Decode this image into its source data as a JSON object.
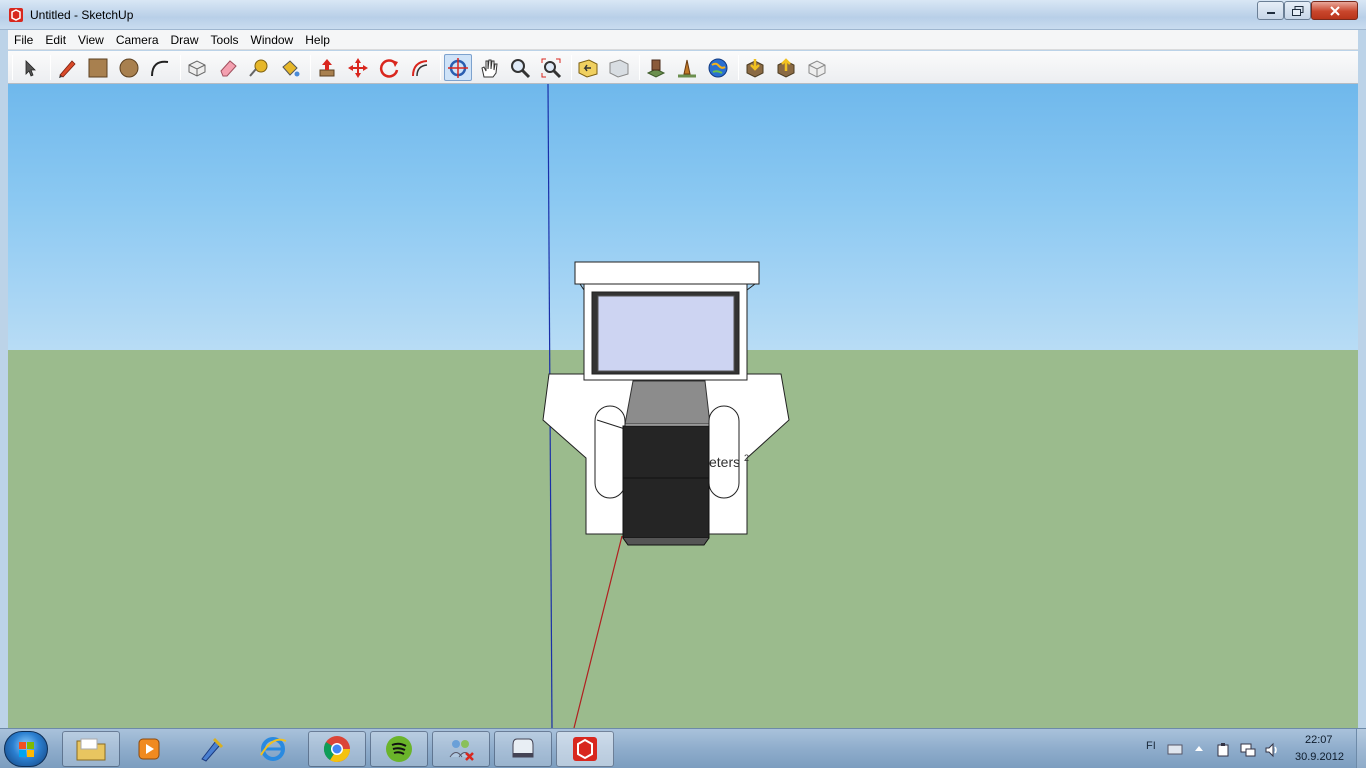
{
  "window": {
    "title": "Untitled - SketchUp"
  },
  "menubar": {
    "items": [
      "File",
      "Edit",
      "View",
      "Camera",
      "Draw",
      "Tools",
      "Window",
      "Help"
    ]
  },
  "toolbar": {
    "tools": [
      {
        "name": "select-tool"
      },
      {
        "name": "line-tool"
      },
      {
        "name": "rectangle-tool"
      },
      {
        "name": "circle-tool"
      },
      {
        "name": "arc-tool"
      },
      {
        "name": "make-component-tool"
      },
      {
        "name": "eraser-tool"
      },
      {
        "name": "tape-measure-tool"
      },
      {
        "name": "paint-bucket-tool"
      },
      {
        "name": "push-pull-tool"
      },
      {
        "name": "move-tool"
      },
      {
        "name": "rotate-tool"
      },
      {
        "name": "offset-tool"
      },
      {
        "name": "orbit-tool",
        "active": true
      },
      {
        "name": "pan-tool"
      },
      {
        "name": "zoom-tool"
      },
      {
        "name": "zoom-extents-tool"
      },
      {
        "name": "previous-view-tool"
      },
      {
        "name": "next-view-tool"
      },
      {
        "name": "add-location-tool"
      },
      {
        "name": "toggle-terrain-tool"
      },
      {
        "name": "google-earth-tool"
      },
      {
        "name": "get-models-tool"
      },
      {
        "name": "share-model-tool"
      },
      {
        "name": "share-component-tool"
      }
    ]
  },
  "viewport": {
    "partial_label": "eters",
    "partial_superscript": "2",
    "colors": {
      "sky": "#8cc9f2",
      "ground": "#9bbb8d",
      "blue_axis": "#1a2fa8",
      "red_axis": "#b02020"
    }
  },
  "taskbar": {
    "apps": [
      {
        "name": "windows-explorer"
      },
      {
        "name": "media-player"
      },
      {
        "name": "tool-app"
      },
      {
        "name": "internet-explorer"
      },
      {
        "name": "google-chrome"
      },
      {
        "name": "spotify"
      },
      {
        "name": "network-app"
      },
      {
        "name": "app-window"
      },
      {
        "name": "sketchup",
        "active": true
      }
    ],
    "language": "FI",
    "time": "22:07",
    "date": "30.9.2012"
  }
}
